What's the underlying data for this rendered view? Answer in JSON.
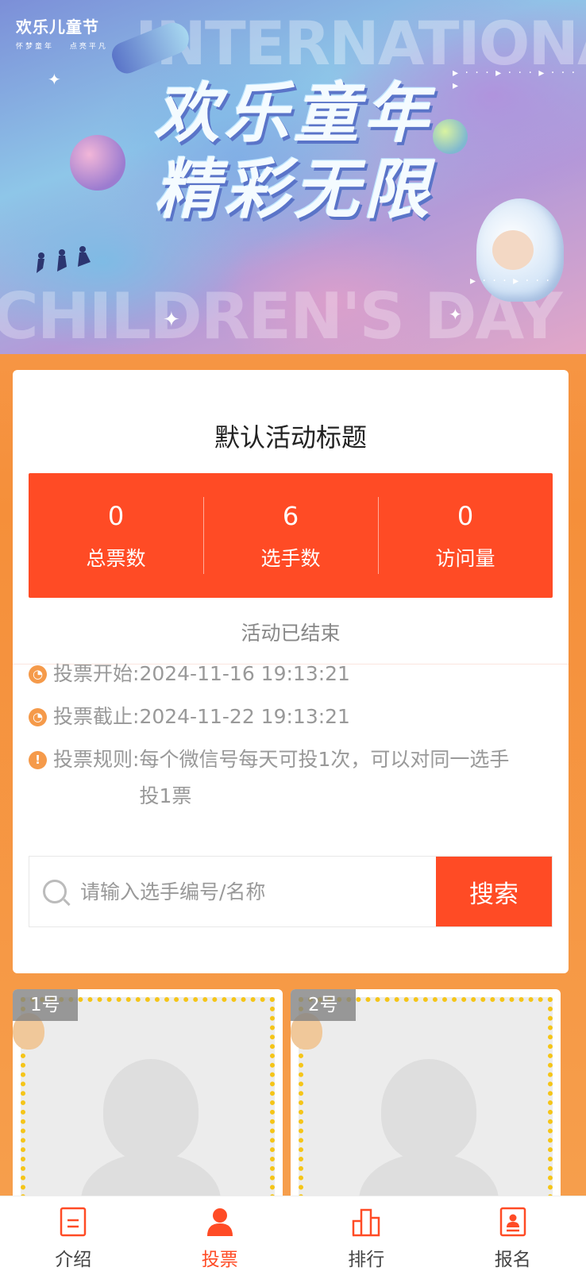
{
  "banner": {
    "brand_title": "欢乐儿童节",
    "brand_sub": "怀梦童年 点亮平凡",
    "big_top": "INTERNATIONAL",
    "big_bottom": "CHILDREN'S DAY",
    "calligraphy_line1": "欢乐童年",
    "calligraphy_line2": "精彩无限"
  },
  "activity": {
    "title": "默认活动标题",
    "stats": [
      {
        "value": "0",
        "label": "总票数"
      },
      {
        "value": "6",
        "label": "选手数"
      },
      {
        "value": "0",
        "label": "访问量"
      }
    ],
    "status": "活动已结束",
    "start_label": "投票开始:",
    "start_value": "2024-11-16 19:13:21",
    "end_label": "投票截止:",
    "end_value": "2024-11-22 19:13:21",
    "rules_label": "投票规则:",
    "rules_value": "每个微信号每天可投1次，可以对同一选手投1票",
    "accent_color": "#ff4b25",
    "icon_color": "#f59a4a"
  },
  "search": {
    "placeholder": "请输入选手编号/名称",
    "button_label": "搜索"
  },
  "contestants": [
    {
      "number": "1号"
    },
    {
      "number": "2号"
    }
  ],
  "tabbar": {
    "items": [
      {
        "label": "介绍",
        "icon": "document-icon",
        "active": false
      },
      {
        "label": "投票",
        "icon": "person-icon",
        "active": true
      },
      {
        "label": "排行",
        "icon": "ranking-icon",
        "active": false
      },
      {
        "label": "报名",
        "icon": "id-card-icon",
        "active": false
      }
    ]
  }
}
